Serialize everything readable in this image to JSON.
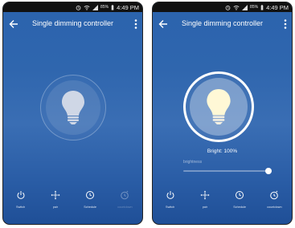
{
  "status_bar": {
    "battery_pct": "85%",
    "time": "4:49 PM"
  },
  "left": {
    "header": {
      "title": "Single dimming controller"
    },
    "bottom_nav": [
      {
        "label": "Switch",
        "icon": "power-icon"
      },
      {
        "label": "pair",
        "icon": "move-icon"
      },
      {
        "label": "Schedule",
        "icon": "clock-icon"
      },
      {
        "label": "countdown",
        "icon": "timer-icon",
        "disabled": true
      }
    ]
  },
  "right": {
    "header": {
      "title": "Single dimming controller"
    },
    "bright": "Bright: 100%",
    "slider": {
      "label": "brightness",
      "value_pct": 100
    },
    "bottom_nav": [
      {
        "label": "Switch",
        "icon": "power-icon"
      },
      {
        "label": "pair",
        "icon": "move-icon"
      },
      {
        "label": "Schedule",
        "icon": "clock-icon"
      },
      {
        "label": "countdown",
        "icon": "timer-icon"
      }
    ]
  },
  "colors": {
    "gradient_top": "#2b63ad",
    "gradient_bottom": "#1f4f97",
    "bulb_off": "#cfd7e6",
    "bulb_on": "#fff8d6"
  }
}
